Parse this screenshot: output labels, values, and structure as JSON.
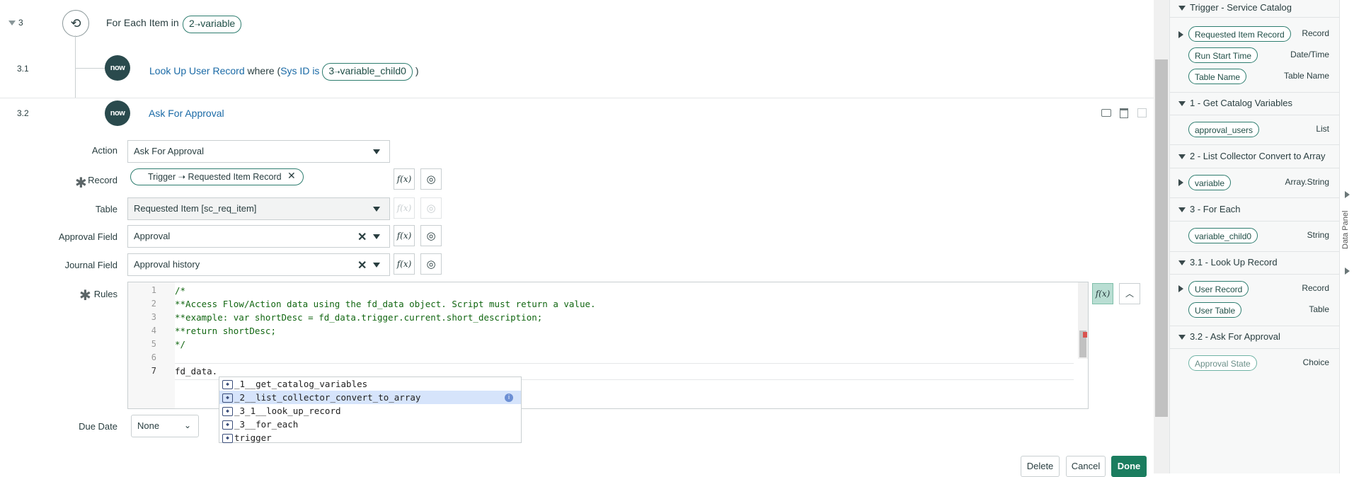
{
  "steps": {
    "s3": {
      "number": "3",
      "label": "For Each Item in",
      "pill_num": "2",
      "pill_arrow": "➝",
      "pill_text": "variable"
    },
    "s31": {
      "number": "3.1",
      "title": "Look Up User Record",
      "where": "where (",
      "field": "Sys ID is",
      "pill_num": "3",
      "pill_arrow": "➝",
      "pill_text": "variable_child0",
      "close": ")"
    },
    "s32": {
      "number": "3.2",
      "title": "Ask For Approval"
    }
  },
  "now_icon": "now",
  "form": {
    "action_label": "Action",
    "action_value": "Ask For Approval",
    "record_label": "Record",
    "record_pill": "Trigger ➝ Requested Item Record",
    "table_label": "Table",
    "table_value": "Requested Item [sc_req_item]",
    "approval_field_label": "Approval Field",
    "approval_field_value": "Approval",
    "journal_field_label": "Journal Field",
    "journal_field_value": "Approval history",
    "rules_label": "Rules",
    "due_date_label": "Due Date",
    "due_date_value": "None",
    "fx": "f(x)"
  },
  "code": {
    "lines": [
      {
        "n": "1",
        "t": "/*"
      },
      {
        "n": "2",
        "t": "**Access Flow/Action data using the fd_data object. Script must return a value."
      },
      {
        "n": "3",
        "t": "**example: var shortDesc = fd_data.trigger.current.short_description;"
      },
      {
        "n": "4",
        "t": "**return shortDesc;"
      },
      {
        "n": "5",
        "t": "*/"
      },
      {
        "n": "6",
        "t": ""
      },
      {
        "n": "7",
        "t": "fd_data."
      }
    ]
  },
  "autocomplete": {
    "items": [
      "_1__get_catalog_variables",
      "_2__list_collector_convert_to_array",
      "_3_1__look_up_record",
      "_3__for_each",
      "trigger"
    ],
    "selected": 1
  },
  "buttons": {
    "delete": "Delete",
    "cancel": "Cancel",
    "done": "Done"
  },
  "data_panel": {
    "rail_label": "Data Panel",
    "sections": [
      {
        "title": "Trigger - Service Catalog",
        "items": [
          {
            "name": "Requested Item Record",
            "type": "Record",
            "expandable": true
          },
          {
            "name": "Run Start Time",
            "type": "Date/Time",
            "expandable": false
          },
          {
            "name": "Table Name",
            "type": "Table Name",
            "expandable": false
          }
        ]
      },
      {
        "title": "1 - Get Catalog Variables",
        "items": [
          {
            "name": "approval_users",
            "type": "List",
            "expandable": false
          }
        ]
      },
      {
        "title": "2 - List Collector Convert to Array",
        "items": [
          {
            "name": "variable",
            "type": "Array.String",
            "expandable": true
          }
        ]
      },
      {
        "title": "3 - For Each",
        "items": [
          {
            "name": "variable_child0",
            "type": "String",
            "expandable": false
          }
        ]
      },
      {
        "title": "3.1 - Look Up Record",
        "items": [
          {
            "name": "User Record",
            "type": "Record",
            "expandable": true
          },
          {
            "name": "User Table",
            "type": "Table",
            "expandable": false
          }
        ]
      },
      {
        "title": "3.2 - Ask For Approval",
        "items": [
          {
            "name": "Approval State",
            "type": "Choice",
            "expandable": false,
            "muted": true
          }
        ]
      }
    ]
  }
}
